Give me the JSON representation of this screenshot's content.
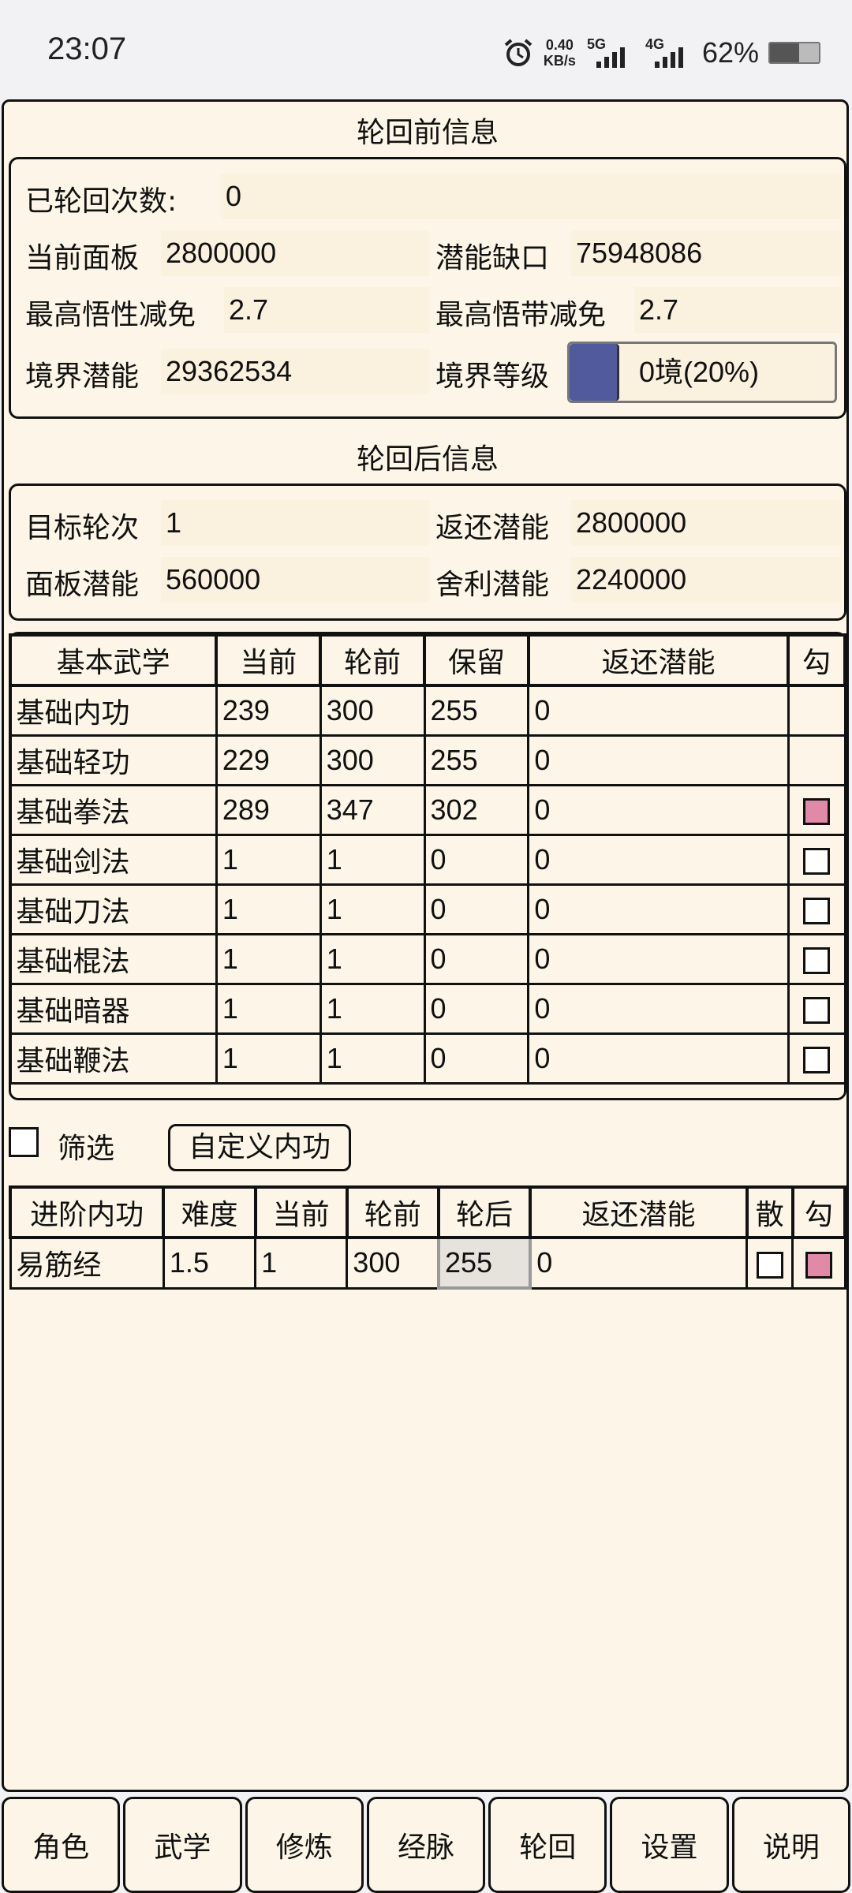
{
  "status_bar": {
    "time": "23:07",
    "net_speed_value": "0.40",
    "net_speed_unit": "KB/s",
    "net1": "5G",
    "net2": "4G",
    "battery_pct": "62%",
    "icons": [
      "alarm-icon",
      "signal-5g-icon",
      "signal-4g-icon",
      "battery-icon"
    ]
  },
  "before": {
    "title": "轮回前信息",
    "reincarnations_label": "已轮回次数:",
    "reincarnations_value": "0",
    "current_panel_label": "当前面板",
    "current_panel_value": "2800000",
    "potential_gap_label": "潜能缺口",
    "potential_gap_value": "75948086",
    "max_wux_label": "最高悟性减免",
    "max_wux_value": "2.7",
    "max_wu_belt_label": "最高悟带减免",
    "max_wu_belt_value": "2.7",
    "realm_potential_label": "境界潜能",
    "realm_potential_value": "29362534",
    "realm_level_label": "境界等级",
    "realm_level_value": "0境(20%)",
    "realm_level_progress": 0.2
  },
  "after": {
    "title": "轮回后信息",
    "target_round_label": "目标轮次",
    "target_round_value": "1",
    "return_potential_label": "返还潜能",
    "return_potential_value": "2800000",
    "panel_potential_label": "面板潜能",
    "panel_potential_value": "560000",
    "relic_potential_label": "舍利潜能",
    "relic_potential_value": "2240000"
  },
  "basic_table": {
    "headers": [
      "基本武学",
      "当前",
      "轮前",
      "保留",
      "返还潜能",
      "勾"
    ],
    "rows": [
      {
        "name": "基础内功",
        "current": "239",
        "before": "300",
        "keep": "255",
        "return": "0",
        "check": "none"
      },
      {
        "name": "基础轻功",
        "current": "229",
        "before": "300",
        "keep": "255",
        "return": "0",
        "check": "none"
      },
      {
        "name": "基础拳法",
        "current": "289",
        "before": "347",
        "keep": "302",
        "return": "0",
        "check": "on"
      },
      {
        "name": "基础剑法",
        "current": "1",
        "before": "1",
        "keep": "0",
        "return": "0",
        "check": "off"
      },
      {
        "name": "基础刀法",
        "current": "1",
        "before": "1",
        "keep": "0",
        "return": "0",
        "check": "off"
      },
      {
        "name": "基础棍法",
        "current": "1",
        "before": "1",
        "keep": "0",
        "return": "0",
        "check": "off"
      },
      {
        "name": "基础暗器",
        "current": "1",
        "before": "1",
        "keep": "0",
        "return": "0",
        "check": "off"
      },
      {
        "name": "基础鞭法",
        "current": "1",
        "before": "1",
        "keep": "0",
        "return": "0",
        "check": "off"
      }
    ]
  },
  "filter": {
    "label": "筛选",
    "custom_button": "自定义内功"
  },
  "advanced_table": {
    "headers": [
      "进阶内功",
      "难度",
      "当前",
      "轮前",
      "轮后",
      "返还潜能",
      "散",
      "勾"
    ],
    "rows": [
      {
        "name": "易筋经",
        "difficulty": "1.5",
        "current": "1",
        "before": "300",
        "after": "255",
        "return": "0",
        "scatter": "off",
        "check": "on"
      }
    ]
  },
  "nav": [
    "角色",
    "武学",
    "修炼",
    "经脉",
    "轮回",
    "设置",
    "说明"
  ],
  "colors": {
    "background": "#fdf6e8",
    "checkbox_on": "#e08aa8",
    "level_fill": "#505a9c"
  }
}
